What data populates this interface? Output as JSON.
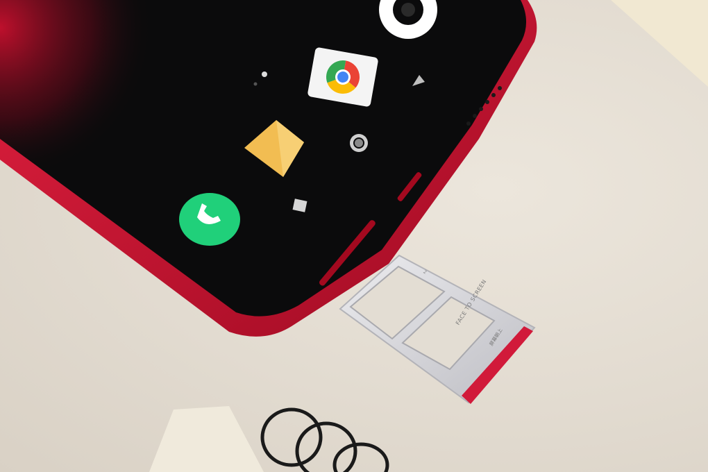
{
  "scene": {
    "description_colors": {
      "phone_body": "#c8102e",
      "screen": "#0b0b0c",
      "surface": "#e6e0d6",
      "tray_metal": "#d8d8dc",
      "call_icon": "#20d07a"
    }
  },
  "phone": {
    "icons": [
      {
        "name": "camera-icon"
      },
      {
        "name": "chrome-icon"
      },
      {
        "name": "gallery-icon"
      },
      {
        "name": "call-icon"
      },
      {
        "name": "back-nav-icon"
      },
      {
        "name": "home-nav-icon"
      },
      {
        "name": "recents-nav-icon"
      }
    ]
  },
  "sim_tray": {
    "engraving": "FACE TO SCREEN",
    "engraving_sub": "屏幕朝上",
    "slot_number": "2"
  }
}
